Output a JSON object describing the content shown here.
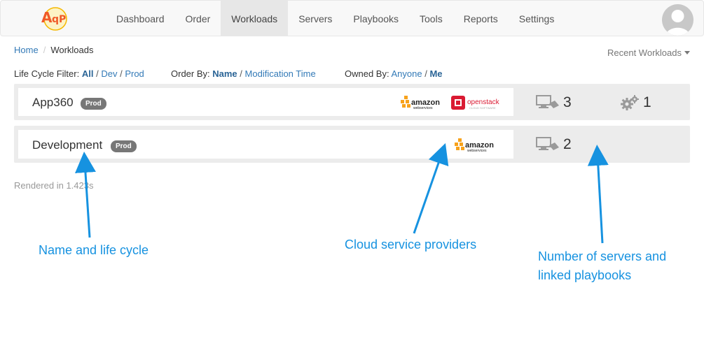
{
  "navbar": {
    "logo_text": "AqP",
    "items": [
      {
        "label": "Dashboard",
        "active": false
      },
      {
        "label": "Order",
        "active": false
      },
      {
        "label": "Workloads",
        "active": true
      },
      {
        "label": "Servers",
        "active": false
      },
      {
        "label": "Playbooks",
        "active": false
      },
      {
        "label": "Tools",
        "active": false
      },
      {
        "label": "Reports",
        "active": false
      },
      {
        "label": "Settings",
        "active": false
      }
    ]
  },
  "breadcrumb": {
    "home": "Home",
    "current": "Workloads"
  },
  "recent_workloads": "Recent Workloads",
  "filters": {
    "lifecycle_label": "Life Cycle Filter:",
    "lifecycle_options": [
      "All",
      "Dev",
      "Prod"
    ],
    "lifecycle_selected": "All",
    "order_label": "Order By:",
    "order_options": [
      "Name",
      "Modification Time"
    ],
    "order_selected": "Name",
    "owned_label": "Owned By:",
    "owned_options": [
      "Anyone",
      "Me"
    ],
    "owned_selected": "Me"
  },
  "workloads": [
    {
      "name": "App360",
      "lifecycle": "Prod",
      "providers": [
        "amazon",
        "openstack"
      ],
      "servers": "3",
      "playbooks": "1"
    },
    {
      "name": "Development",
      "lifecycle": "Prod",
      "providers": [
        "amazon"
      ],
      "servers": "2",
      "playbooks": ""
    }
  ],
  "provider_labels": {
    "amazon": "amazon",
    "amazon_sub": "webservices",
    "openstack": "openstack",
    "openstack_sub": "CLOUD SOFTWARE"
  },
  "rendered": "Rendered in 1.42",
  "rendered_suffix": "3s",
  "annotations": {
    "name_lifecycle": "Name and life cycle",
    "cloud_providers": "Cloud service providers",
    "servers_line1": "Number of servers and",
    "servers_line2": "linked playbooks"
  },
  "colors": {
    "link": "#337ab7",
    "annotation": "#1692e0",
    "badge": "#777777",
    "aws_orange": "#f7a21b",
    "openstack_red": "#da1a32"
  }
}
